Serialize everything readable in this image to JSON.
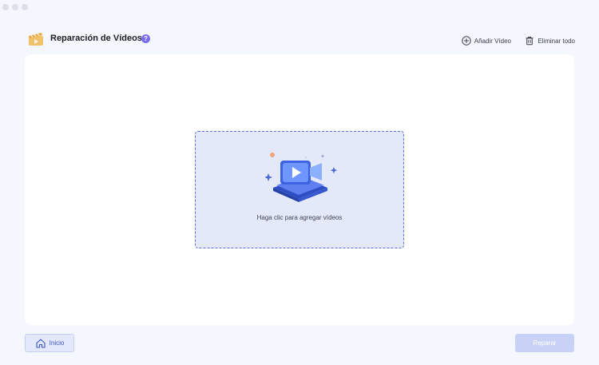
{
  "window": {
    "traffic_lights": [
      "close",
      "minimize",
      "zoom"
    ]
  },
  "header": {
    "app_icon": "video-repair-clapperboard-icon",
    "title": "Reparación de Vídeos",
    "help_glyph": "?",
    "add_label": "Añadir Vídeo",
    "add_icon": "plus-circle-icon",
    "clear_label": "Eliminar todo",
    "clear_icon": "trash-icon"
  },
  "dropzone": {
    "icon": "video-upload-illustration-icon",
    "text": "Haga clic para agregar vídeos"
  },
  "footer": {
    "home_label": "Inicio",
    "home_icon": "home-icon",
    "repair_label": "Reparar"
  },
  "colors": {
    "accent": "#3a55c9",
    "dropzone_bg": "#e4e9fa",
    "dropzone_border": "#5a74d6",
    "help_badge": "#7b6cf0",
    "repair_disabled": "#c8d2f6"
  }
}
